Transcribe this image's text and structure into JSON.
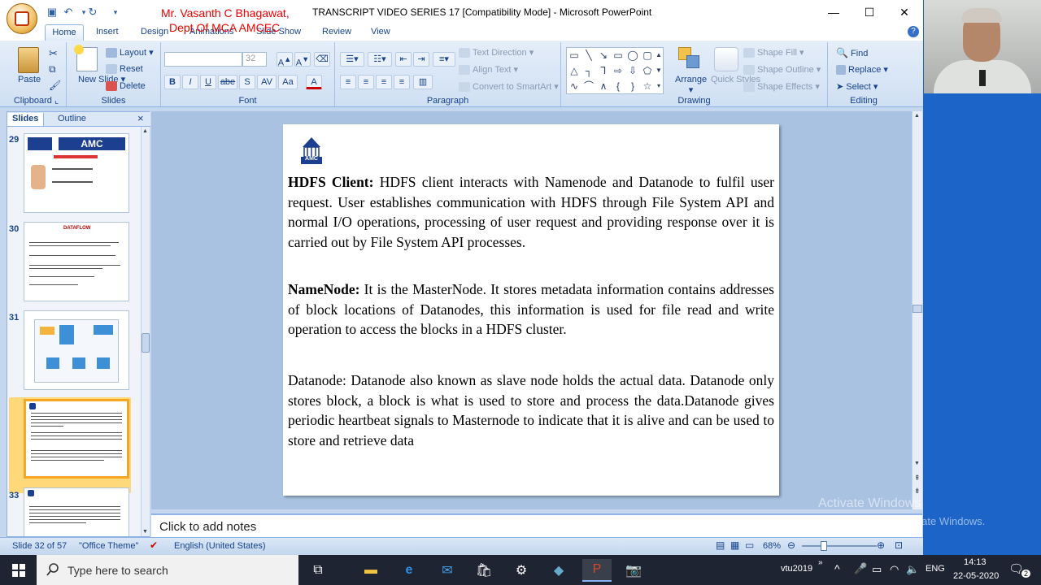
{
  "title_bar": {
    "window_title": "TRANSCRIPT VIDEO SERIES 17 [Compatibility Mode] - Microsoft PowerPoint",
    "author_line1": "Mr. Vasanth C Bhagawat,",
    "author_line2": "Dept Of MCA AMCEC",
    "minimize": "—",
    "maximize": "☐",
    "close": "✕"
  },
  "ribbon_tabs": [
    "Home",
    "Insert",
    "Design",
    "Animations",
    "Slide Show",
    "Review",
    "View"
  ],
  "ribbon": {
    "clipboard": {
      "paste": "Paste",
      "label": "Clipboard"
    },
    "slides": {
      "new_slide": "New Slide",
      "layout": "Layout",
      "reset": "Reset",
      "delete": "Delete",
      "label": "Slides"
    },
    "font": {
      "font_name": "",
      "font_size": "32",
      "bold": "B",
      "italic": "I",
      "underline": "U",
      "strike": "abe",
      "shadow": "S",
      "spacing": "AV",
      "case": "Aa",
      "color": "A",
      "label": "Font"
    },
    "paragraph": {
      "text_direction": "Text Direction",
      "align_text": "Align Text",
      "smartart": "Convert to SmartArt",
      "label": "Paragraph"
    },
    "drawing": {
      "arrange": "Arrange",
      "quick_styles": "Quick Styles",
      "shape_fill": "Shape Fill",
      "shape_outline": "Shape Outline",
      "shape_effects": "Shape Effects",
      "label": "Drawing"
    },
    "editing": {
      "find": "Find",
      "replace": "Replace",
      "select": "Select",
      "label": "Editing"
    }
  },
  "pane_tabs": {
    "slides": "Slides",
    "outline": "Outline",
    "close": "×"
  },
  "thumbnails": [
    {
      "num": "29",
      "header": "AMC"
    },
    {
      "num": "30",
      "header": "DATAFLOW"
    },
    {
      "num": "31",
      "header": ""
    },
    {
      "num": "32",
      "header": ""
    },
    {
      "num": "33",
      "header": ""
    }
  ],
  "slide": {
    "p1_label": "HDFS Client:",
    "p1_text": " HDFS client interacts with Namenode and Datanode to fulfil user request.  User establishes communication with HDFS through File System API and normal I/O operations, processing of user request and providing response over it is carried out by File System API processes.",
    "p2_label": "NameNode:",
    "p2_text": " It is the MasterNode. It stores metadata information contains addresses of block locations of Datanodes, this information is used for file read and write operation to access the blocks in a HDFS cluster.",
    "p3_text": "Datanode: Datanode also known as slave node holds the actual data. Datanode only stores block, a block is what is used to store and process the data.Datanode gives periodic heartbeat signals to Masternode to indicate that it is alive and can be used to store and retrieve data",
    "logo_text": "AMC"
  },
  "notes_placeholder": "Click to add notes",
  "status_bar": {
    "slide_info": "Slide 32 of 57",
    "theme": "\"Office Theme\"",
    "language": "English (United States)",
    "zoom": "68%"
  },
  "watermark": {
    "line1": "Activate Windows",
    "line2": "Go to Settings to activate Windows."
  },
  "taskbar": {
    "search_placeholder": "Type here to search",
    "network": "vtu2019",
    "language": "ENG",
    "time": "14:13",
    "date": "22-05-2020",
    "notification_count": "2"
  },
  "colors": {
    "accent": "#15428b",
    "author_red": "#ee0000",
    "desktop": "#1c64c8"
  }
}
